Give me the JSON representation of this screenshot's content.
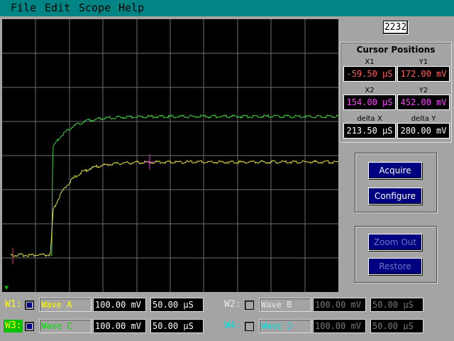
{
  "menu": [
    "File",
    "Edit",
    "Scope",
    "Help"
  ],
  "counter": "2232",
  "cursor_panel": {
    "title": "Cursor Positions",
    "x1_label": "X1",
    "y1_label": "Y1",
    "x2_label": "X2",
    "y2_label": "Y2",
    "dx_label": "delta X",
    "dy_label": "delta Y",
    "x1": "-59.50 µS",
    "y1": "172.00 mV",
    "x2": "154.00 µS",
    "y2": "452.00 mV",
    "dx": "213.50 µS",
    "dy": "280.00 mV"
  },
  "buttons": {
    "acquire": "Acquire",
    "configure": "Configure",
    "zoom_out": "Zoom Out",
    "restore": "Restore"
  },
  "waves": [
    {
      "id": "W1:",
      "name": "Wave A",
      "volts": "100.00 mV",
      "time": "50.00 µS",
      "checked": true,
      "color": "#ffff00",
      "enabled": true
    },
    {
      "id": "W2:",
      "name": "Wave B",
      "volts": "100.00 mV",
      "time": "50.00 µS",
      "checked": false,
      "color": "#e0e0e0",
      "enabled": false
    },
    {
      "id": "W3:",
      "name": "Wave C",
      "volts": "100.00 mV",
      "time": "50.00 µS",
      "checked": true,
      "color": "#00ff00",
      "enabled": true
    },
    {
      "id": "W4:",
      "name": "Wave D",
      "volts": "100.00 mV",
      "time": "50.00 µS",
      "checked": false,
      "color": "#00e0e0",
      "enabled": false
    }
  ],
  "colors": {
    "trace_yellow": "#e0e040",
    "trace_green": "#40d040",
    "grid": "#6e6e6e",
    "cursor_x1": "#e04040",
    "cursor_x2": "#d040d0"
  }
}
